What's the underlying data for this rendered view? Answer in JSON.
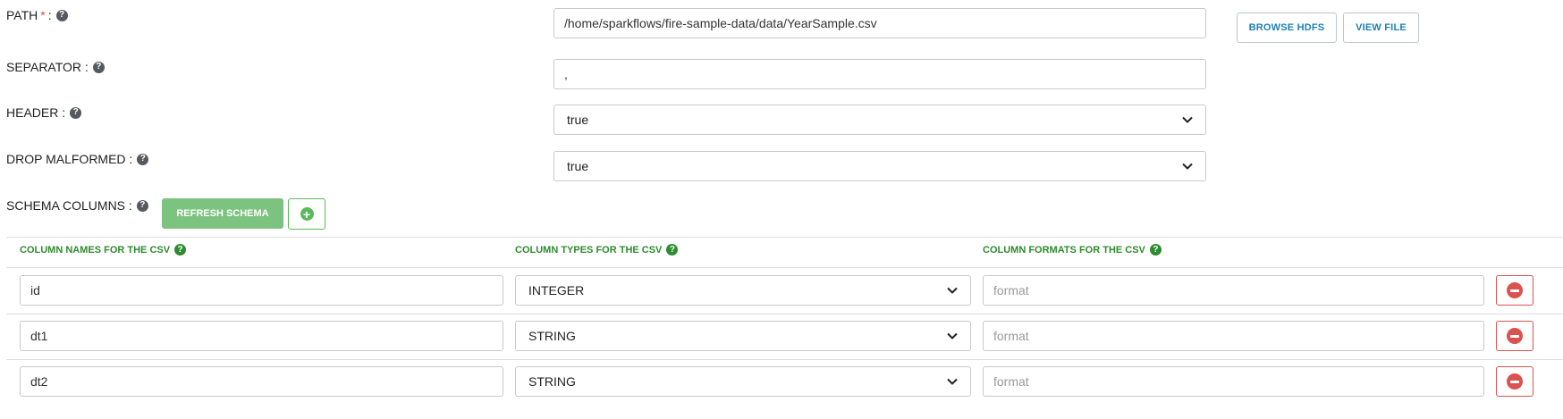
{
  "form": {
    "path": {
      "label": "PATH",
      "required_mark": "*",
      "colon": ":",
      "value": "/home/sparkflows/fire-sample-data/data/YearSample.csv",
      "help_icon": "question-circle-icon"
    },
    "separator": {
      "label": "SEPARATOR :",
      "value": ",",
      "help_icon": "question-circle-icon"
    },
    "header": {
      "label": "HEADER :",
      "value": "true",
      "help_icon": "question-circle-icon"
    },
    "drop_malformed": {
      "label": "DROP MALFORMED :",
      "value": "true",
      "help_icon": "question-circle-icon"
    },
    "schema_columns": {
      "label": "SCHEMA COLUMNS :",
      "help_icon": "question-circle-icon"
    }
  },
  "buttons": {
    "browse_hdfs": "BROWSE HDFS",
    "view_file": "VIEW FILE",
    "refresh_schema": "REFRESH SCHEMA",
    "add_icon": "plus-circle-icon",
    "delete_icon": "minus-circle-icon"
  },
  "table": {
    "headers": [
      "COLUMN NAMES FOR THE CSV",
      "COLUMN TYPES FOR THE CSV",
      "COLUMN FORMATS FOR THE CSV"
    ],
    "rows": [
      {
        "name": "id",
        "type": "INTEGER",
        "format": "",
        "format_placeholder": "format"
      },
      {
        "name": "dt1",
        "type": "STRING",
        "format": "",
        "format_placeholder": "format"
      },
      {
        "name": "dt2",
        "type": "STRING",
        "format": "",
        "format_placeholder": "format"
      }
    ]
  },
  "colors": {
    "header_green": "#2e8b2e",
    "refresh_green": "#7cc37f",
    "delete_red": "#d9534f",
    "link_blue": "#1f7fb8"
  }
}
